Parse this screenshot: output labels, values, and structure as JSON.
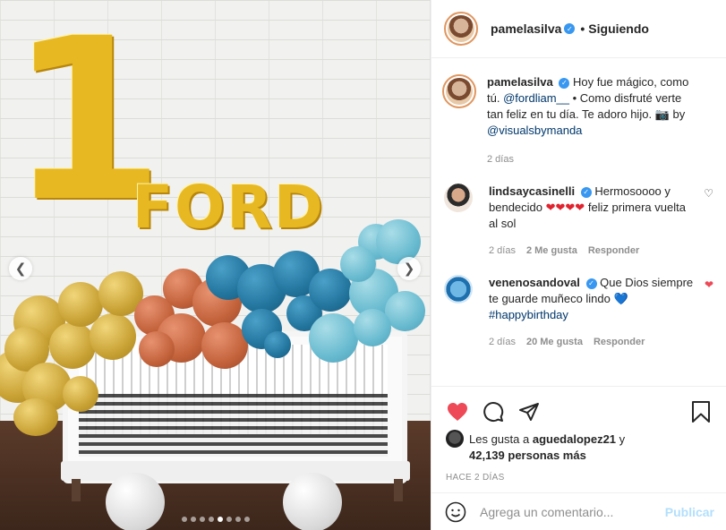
{
  "header": {
    "username": "pamelasilva",
    "verified_icon": "verified-badge-icon",
    "separator": "•",
    "follow_status": "Siguiendo"
  },
  "media": {
    "big_number": "1",
    "word": "FORD",
    "carousel": {
      "total": 8,
      "active_index": 4
    }
  },
  "caption": {
    "username": "pamelasilva",
    "text_before": "Hoy fue mágico, como tú.",
    "mention1": "@fordliam__",
    "text_middle": "• Como disfruté verte tan feliz en tu día. Te adoro hijo. 📷 by",
    "mention2": "@visualsbymanda",
    "time": "2 días"
  },
  "comments": [
    {
      "username": "lindsaycasinelli",
      "text_before": "Hermosoooo y bendecido",
      "hearts": "❤❤❤❤",
      "text_after": "feliz primera vuelta al sol",
      "time": "2 días",
      "likes": "2 Me gusta",
      "reply": "Responder",
      "liked": false
    },
    {
      "username": "venenosandoval",
      "text_before": "Que Dios siempre te guarde muñeco lindo",
      "hearts": "💙",
      "hashtag": "#happybirthday",
      "time": "2 días",
      "likes": "20 Me gusta",
      "reply": "Responder",
      "liked": true
    }
  ],
  "likes": {
    "prefix": "Les gusta a",
    "user": "aguedalopez21",
    "suffix": "y",
    "count": "42,139 personas más"
  },
  "timestamp": "HACE 2 DÍAS",
  "comment_box": {
    "placeholder": "Agrega un comentario...",
    "publish_label": "Publicar"
  },
  "colors": {
    "link": "#00376b",
    "verified": "#3897f0",
    "like_red": "#ed4956",
    "publish_disabled": "#b2dffc"
  }
}
